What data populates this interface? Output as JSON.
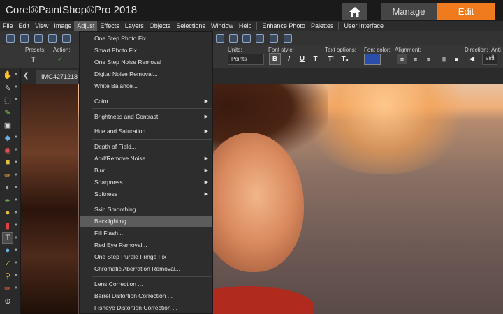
{
  "app": {
    "title": "Corel®PaintShop®Pro 2018",
    "manage_label": "Manage",
    "edit_label": "Edit"
  },
  "colors": {
    "accent": "#f07a1e",
    "font_color_swatch": "#2a4faa"
  },
  "menubar": {
    "items": [
      "File",
      "Edit",
      "View",
      "Image",
      "Adjust",
      "Effects",
      "Layers",
      "Objects",
      "Selections",
      "Window",
      "Help",
      "Enhance Photo",
      "Palettes",
      "User Interface"
    ],
    "active": "Adjust"
  },
  "toolbar2": {
    "presets_label": "Presets:",
    "action_label": "Action:",
    "units_label": "Units:",
    "units_value": "Points",
    "font_style_label": "Font style:",
    "text_options_label": "Text options:",
    "font_color_label": "Font color:",
    "alignment_label": "Alignment:",
    "direction_label": "Direction:",
    "anti_alias_label": "Anti-a",
    "direction_value": "Sha"
  },
  "document": {
    "tab_title": "IMG4271218"
  },
  "adjust_menu": {
    "items": [
      {
        "label": "One Step Photo Fix"
      },
      {
        "label": "Smart Photo Fix..."
      },
      {
        "label": "One Step Noise Removal"
      },
      {
        "label": "Digital Noise Removal..."
      },
      {
        "label": "White Balance..."
      },
      {
        "label": "Color",
        "submenu": true
      },
      {
        "label": "Brightness and Contrast",
        "submenu": true
      },
      {
        "label": "Hue and Saturation",
        "submenu": true
      },
      {
        "label": "Depth of Field..."
      },
      {
        "label": "Add/Remove Noise",
        "submenu": true
      },
      {
        "label": "Blur",
        "submenu": true
      },
      {
        "label": "Sharpness",
        "submenu": true
      },
      {
        "label": "Softness",
        "submenu": true
      },
      {
        "label": "Skin Smoothing..."
      },
      {
        "label": "Backlighting...",
        "highlighted": true
      },
      {
        "label": "Fill Flash..."
      },
      {
        "label": "Red Eye Removal..."
      },
      {
        "label": "One Step Purple Fringe Fix"
      },
      {
        "label": "Chromatic Aberration Removal..."
      },
      {
        "label": "Lens Correction ..."
      },
      {
        "label": "Barrel Distortion Correction ..."
      },
      {
        "label": "Fisheye Distortion Correction ..."
      }
    ]
  }
}
